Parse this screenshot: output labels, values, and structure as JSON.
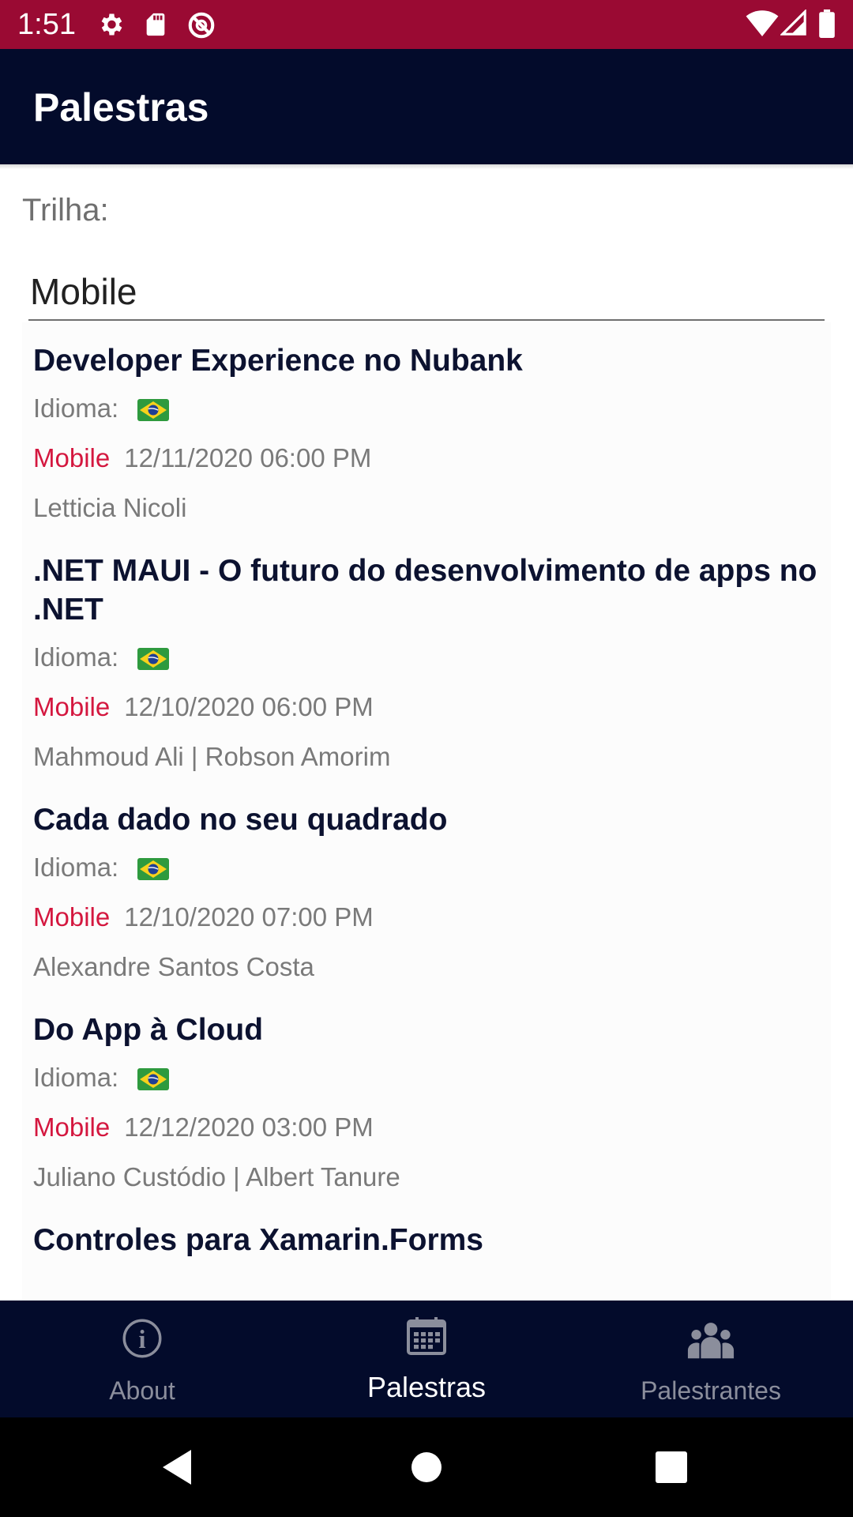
{
  "status_bar": {
    "time": "1:51",
    "left_icons": [
      "gear-icon",
      "sd-card-icon",
      "sync-off-icon"
    ],
    "right_icons": [
      "wifi-icon",
      "signal-icon",
      "battery-icon"
    ],
    "color": "#9a0a33"
  },
  "app_bar": {
    "title": "Palestras",
    "color": "#030b2b"
  },
  "filter": {
    "label": "Trilha:",
    "selected": "Mobile"
  },
  "accent_color": "#d4173f",
  "talks": [
    {
      "title": "Developer Experience no Nubank",
      "idioma_label": "Idioma:",
      "language_flag": "brazil-flag-icon",
      "track": "Mobile",
      "datetime": "12/11/2020 06:00 PM",
      "speakers": "Letticia Nicoli"
    },
    {
      "title": ".NET MAUI - O futuro do desenvolvimento de apps no .NET",
      "idioma_label": "Idioma:",
      "language_flag": "brazil-flag-icon",
      "track": "Mobile",
      "datetime": "12/10/2020 06:00 PM",
      "speakers": "Mahmoud Ali | Robson Amorim"
    },
    {
      "title": "Cada dado no seu quadrado",
      "idioma_label": "Idioma:",
      "language_flag": "brazil-flag-icon",
      "track": "Mobile",
      "datetime": "12/10/2020 07:00 PM",
      "speakers": "Alexandre Santos Costa"
    },
    {
      "title": "Do App à Cloud",
      "idioma_label": "Idioma:",
      "language_flag": "brazil-flag-icon",
      "track": "Mobile",
      "datetime": "12/12/2020 03:00 PM",
      "speakers": "Juliano Custódio | Albert Tanure"
    },
    {
      "title": "Controles para Xamarin.Forms"
    }
  ],
  "tabs": [
    {
      "label": "About",
      "icon": "info-icon",
      "active": false
    },
    {
      "label": "Palestras",
      "icon": "calendar-icon",
      "active": true
    },
    {
      "label": "Palestrantes",
      "icon": "group-icon",
      "active": false
    }
  ],
  "nav_bar": {
    "buttons": [
      "back-icon",
      "home-icon",
      "recents-icon"
    ]
  }
}
